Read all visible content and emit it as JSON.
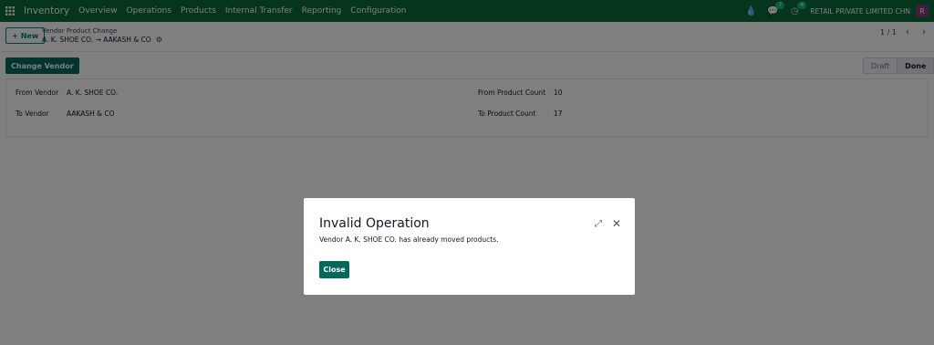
{
  "colors": {
    "navbar": "#0b6a38",
    "primary": "#00695c",
    "avatar": "#7c3f7a"
  },
  "navbar": {
    "app_name": "Inventory",
    "menu": [
      "Overview",
      "Operations",
      "Products",
      "Internal Transfer",
      "Reporting",
      "Configuration"
    ],
    "chat_badge": "7",
    "activity_badge": "4",
    "company": "RETAIL PRIVATE LIMITED CHN",
    "avatar_letter": "R"
  },
  "control": {
    "new_label": "New",
    "breadcrumb_parent": "Vendor Product Change",
    "breadcrumb_current": "A. K. SHOE CO. → AAKASH & CO",
    "pager": "1 / 1"
  },
  "statusbar": {
    "change_vendor_label": "Change Vendor",
    "stages": [
      "Draft",
      "Done"
    ],
    "active_stage": "Done"
  },
  "form": {
    "from_vendor_label": "From Vendor",
    "from_vendor_value": "A. K. SHOE CO.",
    "to_vendor_label": "To Vendor",
    "to_vendor_value": "AAKASH & CO",
    "from_count_label": "From Product Count",
    "from_count_value": "10",
    "to_count_label": "To Product Count",
    "to_count_value": "17"
  },
  "dialog": {
    "title": "Invalid Operation",
    "message": "Vendor A. K. SHOE CO. has already moved products.",
    "close_label": "Close"
  }
}
